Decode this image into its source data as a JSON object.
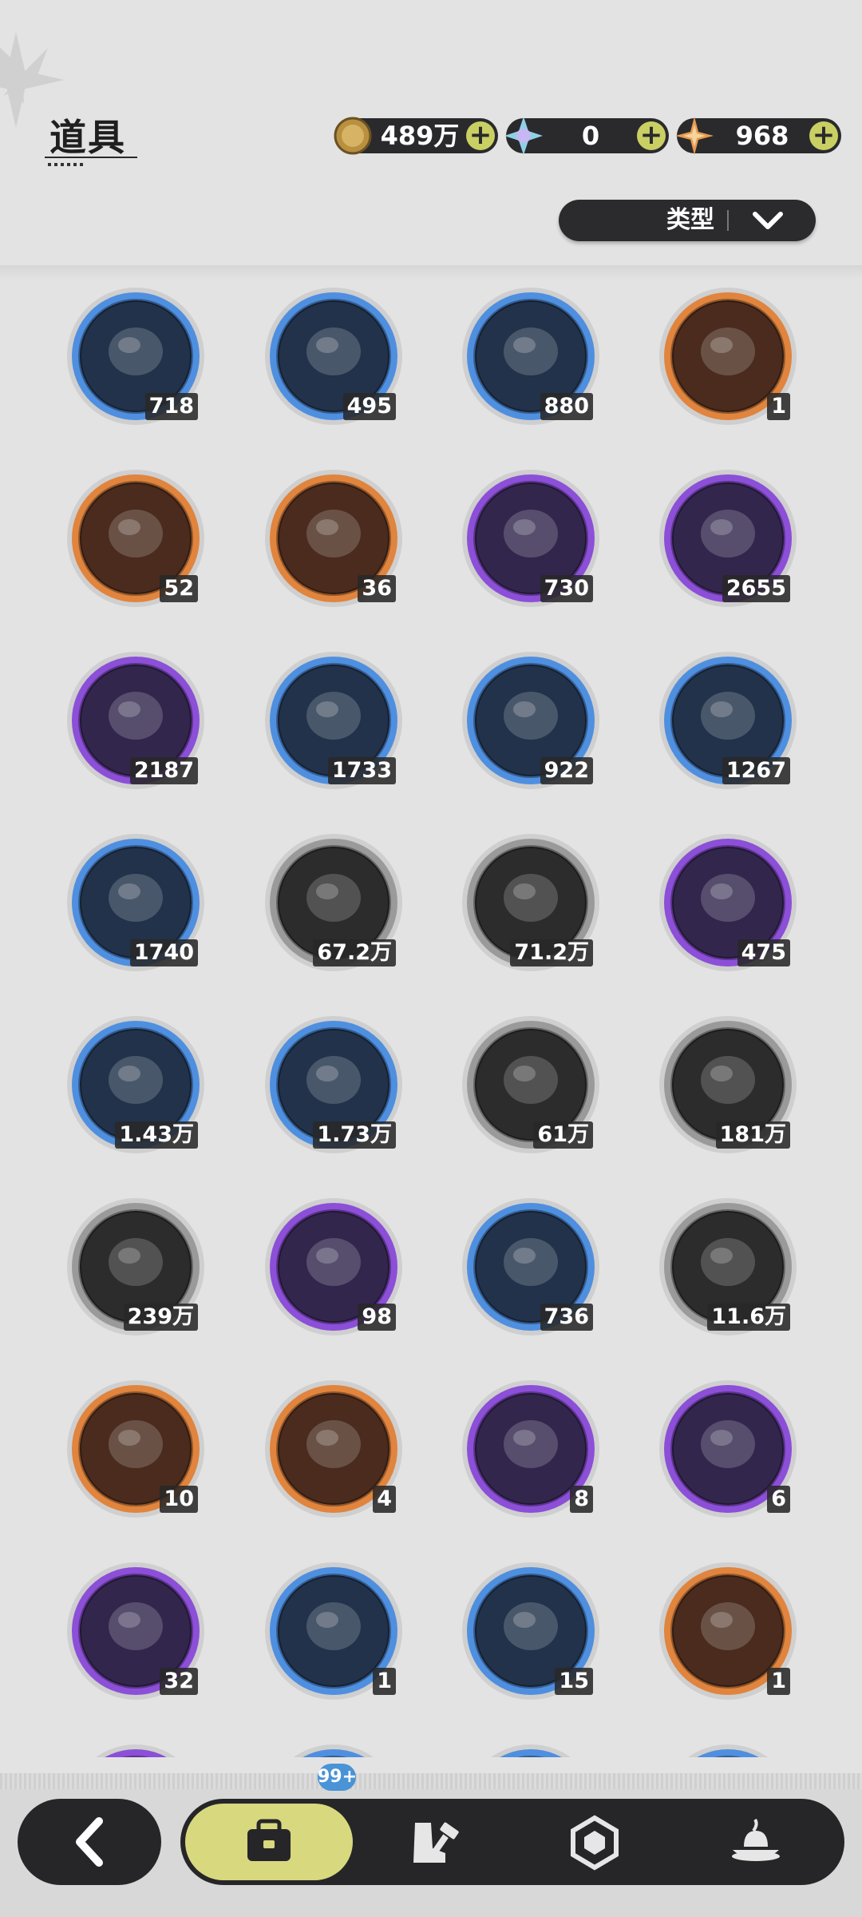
{
  "header": {
    "title": "道具",
    "currencies": [
      {
        "name": "gold-coin",
        "value": "489万",
        "icon": "gold-coin-icon",
        "color": "#caa55a"
      },
      {
        "name": "crystal",
        "value": "0",
        "icon": "crystal-icon",
        "color": "#8fd0e6"
      },
      {
        "name": "star-gem",
        "value": "968",
        "icon": "star-gem-icon",
        "color": "#e59a50"
      }
    ],
    "plus_label": "+"
  },
  "filter": {
    "label": "类型",
    "icon": "chevron-down-icon"
  },
  "items": [
    {
      "count": "718",
      "rarity": "blue",
      "icon": "glove-icon"
    },
    {
      "count": "495",
      "rarity": "blue",
      "icon": "pickaxe-icon"
    },
    {
      "count": "880",
      "rarity": "blue",
      "icon": "hammer-icon"
    },
    {
      "count": "1",
      "rarity": "orange",
      "icon": "potion-icon"
    },
    {
      "count": "52",
      "rarity": "orange",
      "icon": "fruit-icon"
    },
    {
      "count": "36",
      "rarity": "orange",
      "icon": "ticket-icon"
    },
    {
      "count": "730",
      "rarity": "purple",
      "icon": "star-coin-icon"
    },
    {
      "count": "2655",
      "rarity": "purple",
      "icon": "silver-coin-icon"
    },
    {
      "count": "2187",
      "rarity": "purple",
      "icon": "heart-coin-icon"
    },
    {
      "count": "1733",
      "rarity": "blue",
      "icon": "blade-icon"
    },
    {
      "count": "922",
      "rarity": "blue",
      "icon": "scale-icon"
    },
    {
      "count": "1267",
      "rarity": "blue",
      "icon": "gear-icon"
    },
    {
      "count": "1740",
      "rarity": "blue",
      "icon": "leaf-icon"
    },
    {
      "count": "67.2万",
      "rarity": "gray",
      "icon": "wood-icon"
    },
    {
      "count": "71.2万",
      "rarity": "gray",
      "icon": "stone-icon"
    },
    {
      "count": "475",
      "rarity": "purple",
      "icon": "gold-crystal-icon"
    },
    {
      "count": "1.43万",
      "rarity": "blue",
      "icon": "sand-pile-icon"
    },
    {
      "count": "1.73万",
      "rarity": "blue",
      "icon": "red-crystal-icon"
    },
    {
      "count": "61万",
      "rarity": "gray",
      "icon": "powder-icon"
    },
    {
      "count": "181万",
      "rarity": "gray",
      "icon": "dark-crystal-icon"
    },
    {
      "count": "239万",
      "rarity": "gray",
      "icon": "orb-icon"
    },
    {
      "count": "98",
      "rarity": "purple",
      "icon": "pink-bag-icon"
    },
    {
      "count": "736",
      "rarity": "blue",
      "icon": "blue-bag-icon"
    },
    {
      "count": "11.6万",
      "rarity": "gray",
      "icon": "brown-bag-icon"
    },
    {
      "count": "10",
      "rarity": "orange",
      "icon": "cloth-icon"
    },
    {
      "count": "4",
      "rarity": "orange",
      "icon": "bottle-icon"
    },
    {
      "count": "8",
      "rarity": "purple",
      "icon": "egg-icon"
    },
    {
      "count": "6",
      "rarity": "purple",
      "icon": "herb-bundle-icon"
    },
    {
      "count": "32",
      "rarity": "purple",
      "icon": "amber-bottle-icon"
    },
    {
      "count": "1",
      "rarity": "blue",
      "icon": "gray-egg-icon"
    },
    {
      "count": "15",
      "rarity": "blue",
      "icon": "feather-bundle-icon"
    },
    {
      "count": "1",
      "rarity": "orange",
      "icon": "gift-box-icon"
    },
    {
      "count": "",
      "rarity": "purple",
      "icon": "item-icon"
    },
    {
      "count": "",
      "rarity": "blue",
      "icon": "item-icon"
    },
    {
      "count": "",
      "rarity": "blue",
      "icon": "item-icon"
    },
    {
      "count": "",
      "rarity": "blue",
      "icon": "item-icon"
    }
  ],
  "rarity_colors": {
    "blue": {
      "ring": "#4f8fe0",
      "inner": "#22324a"
    },
    "orange": {
      "ring": "#e0843e",
      "inner": "#4a2b1e"
    },
    "purple": {
      "ring": "#8c4fd8",
      "inner": "#33264d"
    },
    "gray": {
      "ring": "#9a9a9a",
      "inner": "#2c2c2c"
    }
  },
  "nav": {
    "back_icon": "back-arrow-icon",
    "tabs": [
      {
        "name": "bag",
        "icon": "bag-icon"
      },
      {
        "name": "equipment",
        "icon": "boot-hammer-icon"
      },
      {
        "name": "crystal",
        "icon": "hexagon-icon"
      },
      {
        "name": "food",
        "icon": "food-icon"
      }
    ],
    "badge": "99+"
  }
}
